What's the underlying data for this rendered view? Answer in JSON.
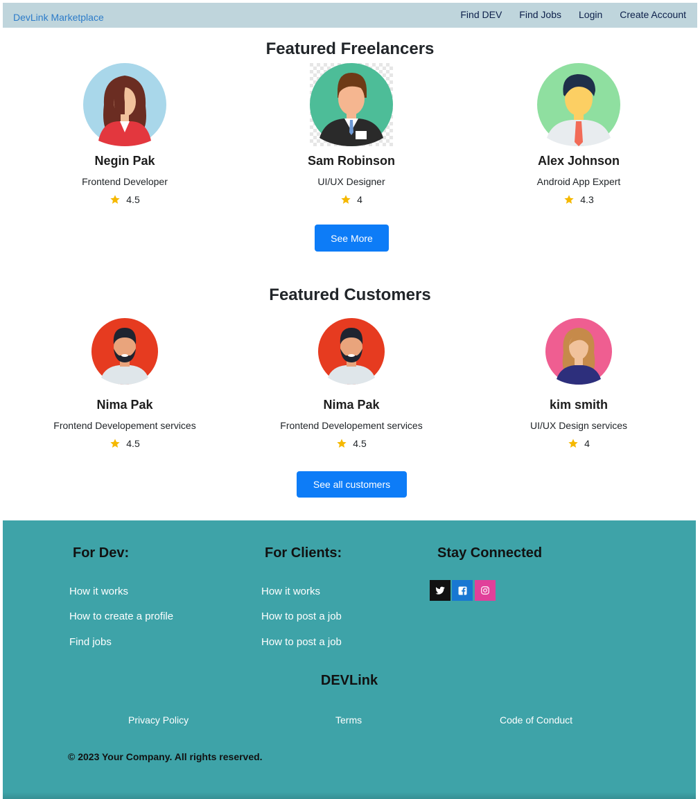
{
  "navbar": {
    "brand": "DevLink Marketplace",
    "links": [
      "Find DEV",
      "Find Jobs",
      "Login",
      "Create Account"
    ]
  },
  "freelancers": {
    "title": "Featured Freelancers",
    "items": [
      {
        "name": "Negin Pak",
        "role": "Frontend Developer",
        "rating": "4.5"
      },
      {
        "name": "Sam Robinson",
        "role": "UI/UX Designer",
        "rating": "4"
      },
      {
        "name": "Alex Johnson",
        "role": "Android App Expert",
        "rating": "4.3"
      }
    ],
    "button": "See More"
  },
  "customers": {
    "title": "Featured Customers",
    "items": [
      {
        "name": "Nima Pak",
        "role": "Frontend Developement services",
        "rating": "4.5"
      },
      {
        "name": "Nima Pak",
        "role": "Frontend Developement services",
        "rating": "4.5"
      },
      {
        "name": "kim smith",
        "role": "UI/UX Design services",
        "rating": "4"
      }
    ],
    "button": "See all customers"
  },
  "footer": {
    "dev": {
      "title": "For Dev:",
      "links": [
        "How it works",
        "How to create a profile",
        "Find jobs"
      ]
    },
    "clients": {
      "title": "For Clients:",
      "links": [
        "How it works",
        "How to post a job",
        "How to post a job"
      ]
    },
    "social": {
      "title": "Stay Connected",
      "icons": [
        "twitter-icon",
        "facebook-icon",
        "instagram-icon"
      ]
    },
    "brand": "DEVLink",
    "policies": [
      "Privacy Policy",
      "Terms",
      "Code of Conduct"
    ],
    "copyright": "© 2023 Your Company. All rights reserved."
  },
  "colors": {
    "navbar_bg": "#bfd5dc",
    "brand": "#2d7cc9",
    "button": "#0d7cf7",
    "footer_bg": "#3ea3a8",
    "star": "#f5b800",
    "twitter": "#111111",
    "facebook": "#1877d2",
    "instagram": "#e1409a"
  }
}
